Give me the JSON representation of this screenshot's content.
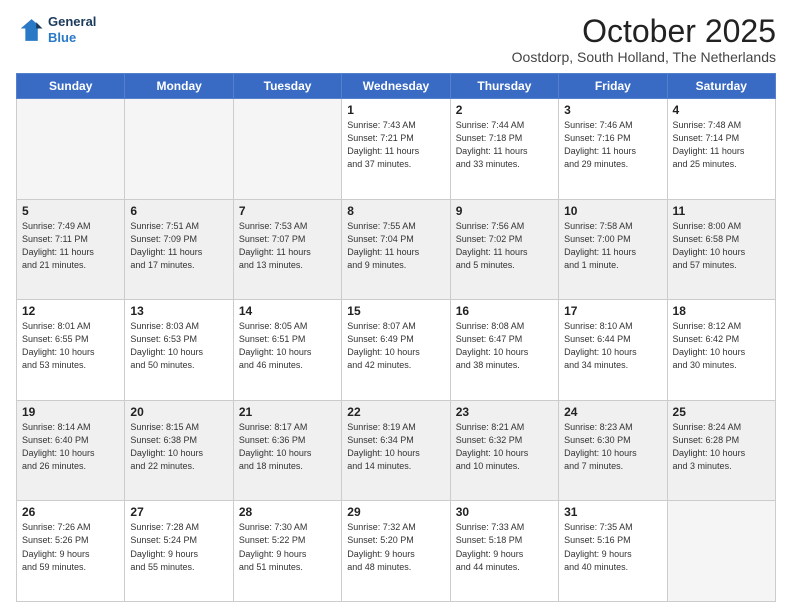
{
  "logo": {
    "line1": "General",
    "line2": "Blue"
  },
  "header": {
    "month": "October 2025",
    "location": "Oostdorp, South Holland, The Netherlands"
  },
  "days_of_week": [
    "Sunday",
    "Monday",
    "Tuesday",
    "Wednesday",
    "Thursday",
    "Friday",
    "Saturday"
  ],
  "weeks": [
    [
      {
        "day": "",
        "info": ""
      },
      {
        "day": "",
        "info": ""
      },
      {
        "day": "",
        "info": ""
      },
      {
        "day": "1",
        "info": "Sunrise: 7:43 AM\nSunset: 7:21 PM\nDaylight: 11 hours\nand 37 minutes."
      },
      {
        "day": "2",
        "info": "Sunrise: 7:44 AM\nSunset: 7:18 PM\nDaylight: 11 hours\nand 33 minutes."
      },
      {
        "day": "3",
        "info": "Sunrise: 7:46 AM\nSunset: 7:16 PM\nDaylight: 11 hours\nand 29 minutes."
      },
      {
        "day": "4",
        "info": "Sunrise: 7:48 AM\nSunset: 7:14 PM\nDaylight: 11 hours\nand 25 minutes."
      }
    ],
    [
      {
        "day": "5",
        "info": "Sunrise: 7:49 AM\nSunset: 7:11 PM\nDaylight: 11 hours\nand 21 minutes."
      },
      {
        "day": "6",
        "info": "Sunrise: 7:51 AM\nSunset: 7:09 PM\nDaylight: 11 hours\nand 17 minutes."
      },
      {
        "day": "7",
        "info": "Sunrise: 7:53 AM\nSunset: 7:07 PM\nDaylight: 11 hours\nand 13 minutes."
      },
      {
        "day": "8",
        "info": "Sunrise: 7:55 AM\nSunset: 7:04 PM\nDaylight: 11 hours\nand 9 minutes."
      },
      {
        "day": "9",
        "info": "Sunrise: 7:56 AM\nSunset: 7:02 PM\nDaylight: 11 hours\nand 5 minutes."
      },
      {
        "day": "10",
        "info": "Sunrise: 7:58 AM\nSunset: 7:00 PM\nDaylight: 11 hours\nand 1 minute."
      },
      {
        "day": "11",
        "info": "Sunrise: 8:00 AM\nSunset: 6:58 PM\nDaylight: 10 hours\nand 57 minutes."
      }
    ],
    [
      {
        "day": "12",
        "info": "Sunrise: 8:01 AM\nSunset: 6:55 PM\nDaylight: 10 hours\nand 53 minutes."
      },
      {
        "day": "13",
        "info": "Sunrise: 8:03 AM\nSunset: 6:53 PM\nDaylight: 10 hours\nand 50 minutes."
      },
      {
        "day": "14",
        "info": "Sunrise: 8:05 AM\nSunset: 6:51 PM\nDaylight: 10 hours\nand 46 minutes."
      },
      {
        "day": "15",
        "info": "Sunrise: 8:07 AM\nSunset: 6:49 PM\nDaylight: 10 hours\nand 42 minutes."
      },
      {
        "day": "16",
        "info": "Sunrise: 8:08 AM\nSunset: 6:47 PM\nDaylight: 10 hours\nand 38 minutes."
      },
      {
        "day": "17",
        "info": "Sunrise: 8:10 AM\nSunset: 6:44 PM\nDaylight: 10 hours\nand 34 minutes."
      },
      {
        "day": "18",
        "info": "Sunrise: 8:12 AM\nSunset: 6:42 PM\nDaylight: 10 hours\nand 30 minutes."
      }
    ],
    [
      {
        "day": "19",
        "info": "Sunrise: 8:14 AM\nSunset: 6:40 PM\nDaylight: 10 hours\nand 26 minutes."
      },
      {
        "day": "20",
        "info": "Sunrise: 8:15 AM\nSunset: 6:38 PM\nDaylight: 10 hours\nand 22 minutes."
      },
      {
        "day": "21",
        "info": "Sunrise: 8:17 AM\nSunset: 6:36 PM\nDaylight: 10 hours\nand 18 minutes."
      },
      {
        "day": "22",
        "info": "Sunrise: 8:19 AM\nSunset: 6:34 PM\nDaylight: 10 hours\nand 14 minutes."
      },
      {
        "day": "23",
        "info": "Sunrise: 8:21 AM\nSunset: 6:32 PM\nDaylight: 10 hours\nand 10 minutes."
      },
      {
        "day": "24",
        "info": "Sunrise: 8:23 AM\nSunset: 6:30 PM\nDaylight: 10 hours\nand 7 minutes."
      },
      {
        "day": "25",
        "info": "Sunrise: 8:24 AM\nSunset: 6:28 PM\nDaylight: 10 hours\nand 3 minutes."
      }
    ],
    [
      {
        "day": "26",
        "info": "Sunrise: 7:26 AM\nSunset: 5:26 PM\nDaylight: 9 hours\nand 59 minutes."
      },
      {
        "day": "27",
        "info": "Sunrise: 7:28 AM\nSunset: 5:24 PM\nDaylight: 9 hours\nand 55 minutes."
      },
      {
        "day": "28",
        "info": "Sunrise: 7:30 AM\nSunset: 5:22 PM\nDaylight: 9 hours\nand 51 minutes."
      },
      {
        "day": "29",
        "info": "Sunrise: 7:32 AM\nSunset: 5:20 PM\nDaylight: 9 hours\nand 48 minutes."
      },
      {
        "day": "30",
        "info": "Sunrise: 7:33 AM\nSunset: 5:18 PM\nDaylight: 9 hours\nand 44 minutes."
      },
      {
        "day": "31",
        "info": "Sunrise: 7:35 AM\nSunset: 5:16 PM\nDaylight: 9 hours\nand 40 minutes."
      },
      {
        "day": "",
        "info": ""
      }
    ]
  ]
}
